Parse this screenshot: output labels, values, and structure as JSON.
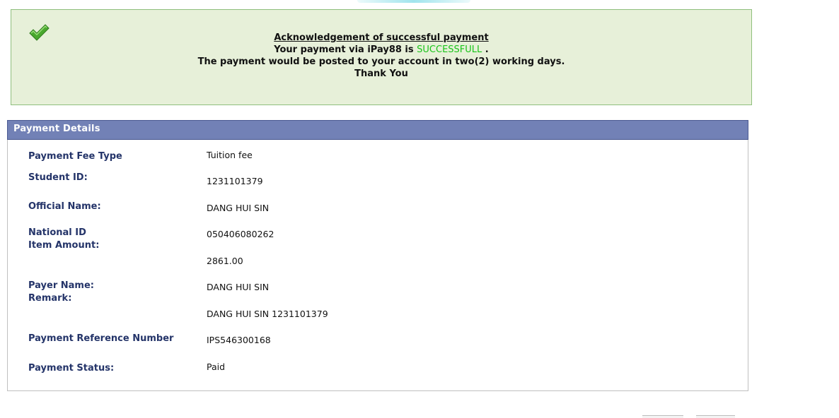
{
  "acknowledgement": {
    "title": "Acknowledgement of successful payment",
    "line1_prefix": "Your payment via iPay88 is ",
    "status_word": "SUCCESSFULL",
    "line1_suffix": " .",
    "line2": "The payment would be posted to your account in two(2) working days.",
    "line3": "Thank You"
  },
  "details": {
    "header": "Payment Details",
    "labels": {
      "fee_type": "Payment Fee Type",
      "student_id": "Student ID:",
      "official_name": "Official Name:",
      "national_id": "National ID",
      "item_amount": "Item Amount:",
      "payer_name": "Payer Name:",
      "remark": "Remark:",
      "reference_number": "Payment Reference Number",
      "payment_status": "Payment Status:"
    },
    "values": {
      "fee_type": "Tuition fee",
      "student_id": "1231101379",
      "official_name": "DANG HUI SIN",
      "national_id": "050406080262",
      "item_amount": "2861.00",
      "payer_name": "DANG HUI SIN",
      "remark": "DANG HUI SIN 1231101379",
      "reference_number": "IPS546300168",
      "payment_status": "Paid"
    }
  },
  "colors": {
    "success_green": "#19c419",
    "header_blue": "#7281b6",
    "label_navy": "#243469",
    "ack_background": "#e7f0d9"
  },
  "icons": {
    "success": "check-icon"
  }
}
